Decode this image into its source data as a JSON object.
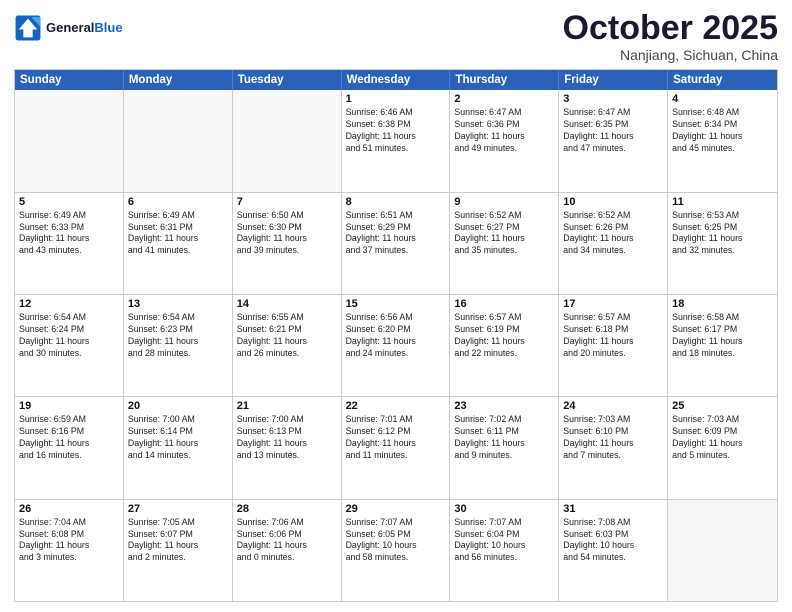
{
  "header": {
    "logo_line1": "General",
    "logo_line2": "Blue",
    "month": "October 2025",
    "location": "Nanjiang, Sichuan, China"
  },
  "weekdays": [
    "Sunday",
    "Monday",
    "Tuesday",
    "Wednesday",
    "Thursday",
    "Friday",
    "Saturday"
  ],
  "rows": [
    [
      {
        "day": "",
        "info": ""
      },
      {
        "day": "",
        "info": ""
      },
      {
        "day": "",
        "info": ""
      },
      {
        "day": "1",
        "info": "Sunrise: 6:46 AM\nSunset: 6:38 PM\nDaylight: 11 hours\nand 51 minutes."
      },
      {
        "day": "2",
        "info": "Sunrise: 6:47 AM\nSunset: 6:36 PM\nDaylight: 11 hours\nand 49 minutes."
      },
      {
        "day": "3",
        "info": "Sunrise: 6:47 AM\nSunset: 6:35 PM\nDaylight: 11 hours\nand 47 minutes."
      },
      {
        "day": "4",
        "info": "Sunrise: 6:48 AM\nSunset: 6:34 PM\nDaylight: 11 hours\nand 45 minutes."
      }
    ],
    [
      {
        "day": "5",
        "info": "Sunrise: 6:49 AM\nSunset: 6:33 PM\nDaylight: 11 hours\nand 43 minutes."
      },
      {
        "day": "6",
        "info": "Sunrise: 6:49 AM\nSunset: 6:31 PM\nDaylight: 11 hours\nand 41 minutes."
      },
      {
        "day": "7",
        "info": "Sunrise: 6:50 AM\nSunset: 6:30 PM\nDaylight: 11 hours\nand 39 minutes."
      },
      {
        "day": "8",
        "info": "Sunrise: 6:51 AM\nSunset: 6:29 PM\nDaylight: 11 hours\nand 37 minutes."
      },
      {
        "day": "9",
        "info": "Sunrise: 6:52 AM\nSunset: 6:27 PM\nDaylight: 11 hours\nand 35 minutes."
      },
      {
        "day": "10",
        "info": "Sunrise: 6:52 AM\nSunset: 6:26 PM\nDaylight: 11 hours\nand 34 minutes."
      },
      {
        "day": "11",
        "info": "Sunrise: 6:53 AM\nSunset: 6:25 PM\nDaylight: 11 hours\nand 32 minutes."
      }
    ],
    [
      {
        "day": "12",
        "info": "Sunrise: 6:54 AM\nSunset: 6:24 PM\nDaylight: 11 hours\nand 30 minutes."
      },
      {
        "day": "13",
        "info": "Sunrise: 6:54 AM\nSunset: 6:23 PM\nDaylight: 11 hours\nand 28 minutes."
      },
      {
        "day": "14",
        "info": "Sunrise: 6:55 AM\nSunset: 6:21 PM\nDaylight: 11 hours\nand 26 minutes."
      },
      {
        "day": "15",
        "info": "Sunrise: 6:56 AM\nSunset: 6:20 PM\nDaylight: 11 hours\nand 24 minutes."
      },
      {
        "day": "16",
        "info": "Sunrise: 6:57 AM\nSunset: 6:19 PM\nDaylight: 11 hours\nand 22 minutes."
      },
      {
        "day": "17",
        "info": "Sunrise: 6:57 AM\nSunset: 6:18 PM\nDaylight: 11 hours\nand 20 minutes."
      },
      {
        "day": "18",
        "info": "Sunrise: 6:58 AM\nSunset: 6:17 PM\nDaylight: 11 hours\nand 18 minutes."
      }
    ],
    [
      {
        "day": "19",
        "info": "Sunrise: 6:59 AM\nSunset: 6:16 PM\nDaylight: 11 hours\nand 16 minutes."
      },
      {
        "day": "20",
        "info": "Sunrise: 7:00 AM\nSunset: 6:14 PM\nDaylight: 11 hours\nand 14 minutes."
      },
      {
        "day": "21",
        "info": "Sunrise: 7:00 AM\nSunset: 6:13 PM\nDaylight: 11 hours\nand 13 minutes."
      },
      {
        "day": "22",
        "info": "Sunrise: 7:01 AM\nSunset: 6:12 PM\nDaylight: 11 hours\nand 11 minutes."
      },
      {
        "day": "23",
        "info": "Sunrise: 7:02 AM\nSunset: 6:11 PM\nDaylight: 11 hours\nand 9 minutes."
      },
      {
        "day": "24",
        "info": "Sunrise: 7:03 AM\nSunset: 6:10 PM\nDaylight: 11 hours\nand 7 minutes."
      },
      {
        "day": "25",
        "info": "Sunrise: 7:03 AM\nSunset: 6:09 PM\nDaylight: 11 hours\nand 5 minutes."
      }
    ],
    [
      {
        "day": "26",
        "info": "Sunrise: 7:04 AM\nSunset: 6:08 PM\nDaylight: 11 hours\nand 3 minutes."
      },
      {
        "day": "27",
        "info": "Sunrise: 7:05 AM\nSunset: 6:07 PM\nDaylight: 11 hours\nand 2 minutes."
      },
      {
        "day": "28",
        "info": "Sunrise: 7:06 AM\nSunset: 6:06 PM\nDaylight: 11 hours\nand 0 minutes."
      },
      {
        "day": "29",
        "info": "Sunrise: 7:07 AM\nSunset: 6:05 PM\nDaylight: 10 hours\nand 58 minutes."
      },
      {
        "day": "30",
        "info": "Sunrise: 7:07 AM\nSunset: 6:04 PM\nDaylight: 10 hours\nand 56 minutes."
      },
      {
        "day": "31",
        "info": "Sunrise: 7:08 AM\nSunset: 6:03 PM\nDaylight: 10 hours\nand 54 minutes."
      },
      {
        "day": "",
        "info": ""
      }
    ]
  ]
}
